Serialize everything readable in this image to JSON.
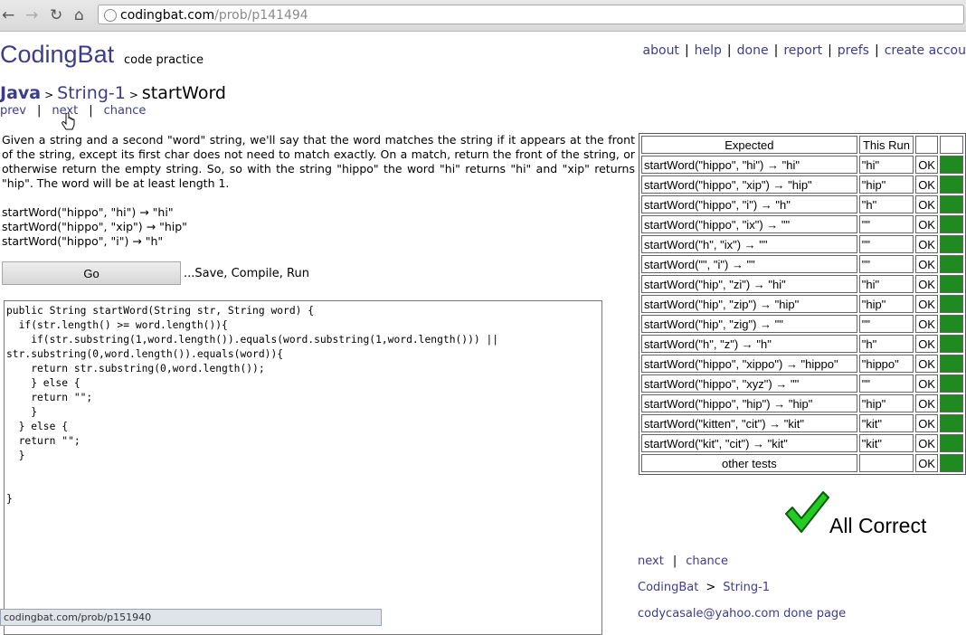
{
  "browser": {
    "url_host": "codingbat.com",
    "url_path": "/prob/p141494",
    "status_url": "codingbat.com/prob/p151940"
  },
  "header": {
    "brand": "CodingBat",
    "tagline": "code practice",
    "nav": [
      "about",
      "help",
      "done",
      "report",
      "prefs",
      "create accou"
    ]
  },
  "breadcrumb": {
    "language": "Java",
    "category": "String-1",
    "problem": "startWord"
  },
  "probnav": {
    "prev": "prev",
    "next": "next",
    "chance": "chance"
  },
  "problem": {
    "description": "Given a string and a second \"word\" string, we'll say that the word matches the string if it appears at the front of the string, except its first char does not need to match exactly. On a match, return the front of the string, or otherwise return the empty string. So, so with the string \"hippo\" the word \"hi\" returns \"hi\" and \"xip\" returns \"hip\". The word will be at least length 1.",
    "examples": [
      "startWord(\"hippo\", \"hi\") → \"hi\"",
      "startWord(\"hippo\", \"xip\") → \"hip\"",
      "startWord(\"hippo\", \"i\") → \"h\""
    ]
  },
  "editor": {
    "go_label": "Go",
    "go_hint": "...Save, Compile, Run",
    "code": "public String startWord(String str, String word) {\n  if(str.length() >= word.length()){\n    if(str.substring(1,word.length()).equals(word.substring(1,word.length())) ||\nstr.substring(0,word.length()).equals(word)){\n    return str.substring(0,word.length());\n    } else {\n    return \"\";\n    }\n  } else {\n  return \"\";\n  }\n\n\n}"
  },
  "results": {
    "headers": [
      "Expected",
      "This Run",
      "",
      ""
    ],
    "rows": [
      {
        "expected": "startWord(\"hippo\", \"hi\") → \"hi\"",
        "run": "\"hi\"",
        "status": "OK"
      },
      {
        "expected": "startWord(\"hippo\", \"xip\") → \"hip\"",
        "run": "\"hip\"",
        "status": "OK"
      },
      {
        "expected": "startWord(\"hippo\", \"i\") → \"h\"",
        "run": "\"h\"",
        "status": "OK"
      },
      {
        "expected": "startWord(\"hippo\", \"ix\") → \"\"",
        "run": "\"\"",
        "status": "OK"
      },
      {
        "expected": "startWord(\"h\", \"ix\") → \"\"",
        "run": "\"\"",
        "status": "OK"
      },
      {
        "expected": "startWord(\"\", \"i\") → \"\"",
        "run": "\"\"",
        "status": "OK"
      },
      {
        "expected": "startWord(\"hip\", \"zi\") → \"hi\"",
        "run": "\"hi\"",
        "status": "OK"
      },
      {
        "expected": "startWord(\"hip\", \"zip\") → \"hip\"",
        "run": "\"hip\"",
        "status": "OK"
      },
      {
        "expected": "startWord(\"hip\", \"zig\") → \"\"",
        "run": "\"\"",
        "status": "OK"
      },
      {
        "expected": "startWord(\"h\", \"z\") → \"h\"",
        "run": "\"h\"",
        "status": "OK"
      },
      {
        "expected": "startWord(\"hippo\", \"xippo\") → \"hippo\"",
        "run": "\"hippo\"",
        "status": "OK"
      },
      {
        "expected": "startWord(\"hippo\", \"xyz\") → \"\"",
        "run": "\"\"",
        "status": "OK"
      },
      {
        "expected": "startWord(\"hippo\", \"hip\") → \"hip\"",
        "run": "\"hip\"",
        "status": "OK"
      },
      {
        "expected": "startWord(\"kitten\", \"cit\") → \"kit\"",
        "run": "\"kit\"",
        "status": "OK"
      },
      {
        "expected": "startWord(\"kit\", \"cit\") → \"kit\"",
        "run": "\"kit\"",
        "status": "OK"
      },
      {
        "expected": "other tests",
        "run": "",
        "status": "OK"
      }
    ],
    "pass_color": "#1f8a1f"
  },
  "result_banner": {
    "text": "All Correct",
    "icon": "checkmark-icon",
    "icon_color": "#22cc22"
  },
  "bottom": {
    "next": "next",
    "chance": "chance",
    "home": "CodingBat",
    "category": "String-1",
    "user": "codycasale@yahoo.com done page"
  }
}
